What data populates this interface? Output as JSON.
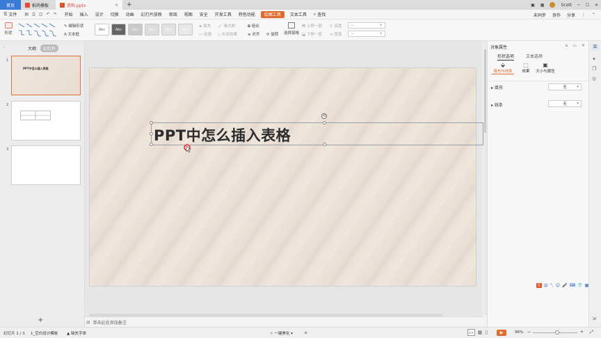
{
  "tabs": [
    {
      "label": "首页"
    },
    {
      "label": "稻壳模板"
    },
    {
      "label": "资料.pptx"
    }
  ],
  "tab_add": "+",
  "window": {
    "user": "Scott"
  },
  "menu": {
    "file": "文件",
    "items": [
      "开始",
      "插入",
      "设计",
      "切换",
      "动画",
      "幻灯片放映",
      "审阅",
      "视图",
      "安全",
      "开发工具",
      "特色功能",
      "绘图工具",
      "文本工具"
    ],
    "active": "绘图工具",
    "search": "查找",
    "right": [
      "未同步",
      "协作",
      "分享"
    ]
  },
  "ribbon": {
    "shape_label": "形状",
    "edit_shape": "编辑形状",
    "text_box": "文本框",
    "style_label": "Abc",
    "fill": "填充",
    "outline": "轮廓",
    "format_painter": "格式刷",
    "shape_effect": "形状效果",
    "combine": "组合",
    "align": "对齐",
    "rotate": "旋转",
    "select_pane": "选择窗格",
    "up_layer": "上移一层",
    "down_layer": "下移一层",
    "height": "高度",
    "width": "宽度"
  },
  "leftpanel": {
    "outline_tab": "大纲",
    "slides_tab": "幻灯片",
    "slides": [
      {
        "num": "1",
        "title": "PPT中怎么插入表格"
      },
      {
        "num": "2"
      },
      {
        "num": "3"
      }
    ],
    "add": "+"
  },
  "slide": {
    "title": "PPT中怎么插入表格"
  },
  "notes": {
    "placeholder": "单击此处添加备注"
  },
  "rightpanel": {
    "title": "对象属性",
    "tabs": [
      "形状选项",
      "文本选项"
    ],
    "subtabs": [
      "填充与线条",
      "效果",
      "大小与属性"
    ],
    "fill_label": "填充",
    "fill_value": "无",
    "line_label": "线条",
    "line_value": "无"
  },
  "status": {
    "slide_count": "幻灯片 1 / 3",
    "template": "1_空白设计模板",
    "font_missing": "缺失字体",
    "beautify": "一键美化",
    "zoom": "96%"
  },
  "colors": {
    "accent": "#e06b2d",
    "home_tab": "#3a7bd5"
  }
}
